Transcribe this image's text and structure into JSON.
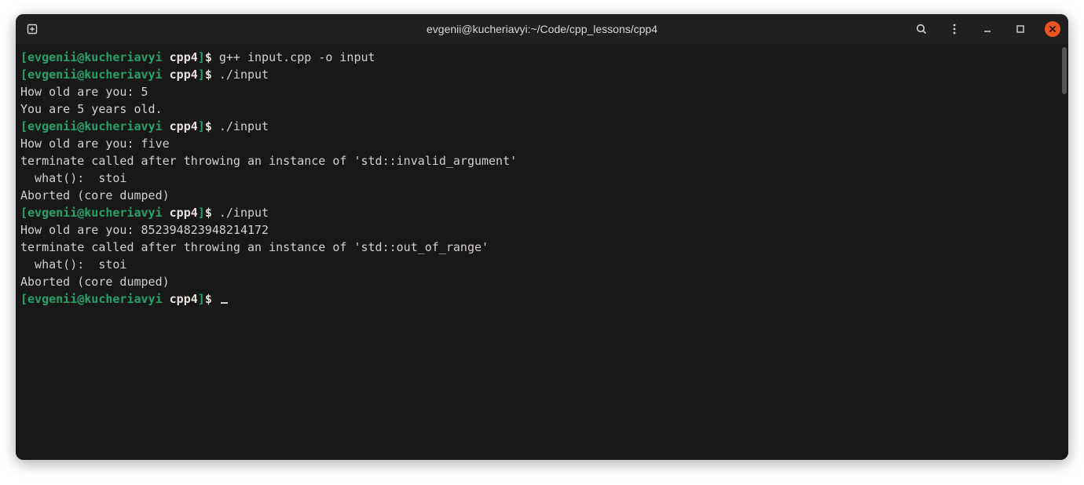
{
  "titlebar": {
    "title": "evgenii@kucheriavyi:~/Code/cpp_lessons/cpp4"
  },
  "prompt": {
    "open": "[",
    "userhost": "evgenii@kucheriavyi",
    "space": " ",
    "dir": "cpp4",
    "close": "]",
    "dollar": "$ "
  },
  "lines": {
    "cmd1": "g++ input.cpp -o input",
    "cmd2": "./input",
    "out1": "How old are you: 5",
    "out2": "You are 5 years old.",
    "cmd3": "./input",
    "out3": "How old are you: five",
    "out4": "terminate called after throwing an instance of 'std::invalid_argument'",
    "out5": "  what():  stoi",
    "out6": "Aborted (core dumped)",
    "cmd4": "./input",
    "out7": "How old are you: 852394823948214172",
    "out8": "terminate called after throwing an instance of 'std::out_of_range'",
    "out9": "  what():  stoi",
    "out10": "Aborted (core dumped)"
  }
}
